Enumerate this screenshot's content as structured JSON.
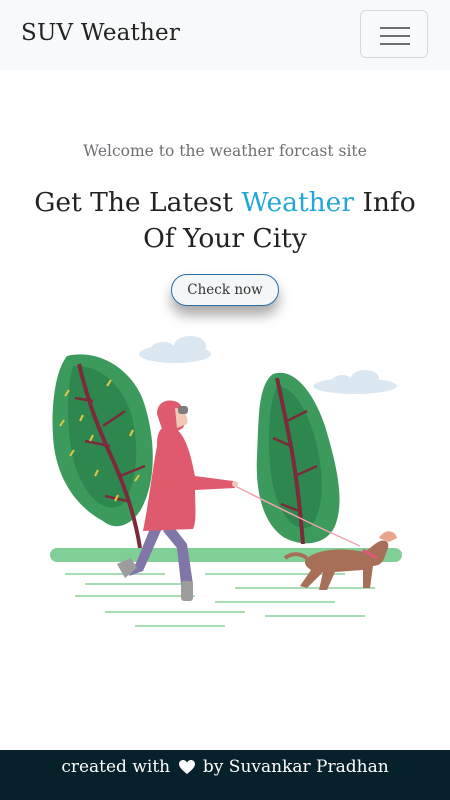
{
  "navbar": {
    "brand": "SUV Weather",
    "menu_icon": "hamburger-menu-icon"
  },
  "hero": {
    "welcome": "Welcome to the weather forcast site",
    "headline_prefix": "Get The Latest ",
    "headline_accent": "Weather",
    "headline_suffix": " Info Of Your City",
    "button_label": "Check now",
    "illustration": "woman-walking-dog-in-wind-illustration"
  },
  "footer": {
    "prefix": "created with",
    "heart_icon": "heart-icon",
    "suffix": "by Suvankar Pradhan"
  },
  "colors": {
    "accent": "#22a6d8",
    "footer_bg": "#06202c",
    "navbar_bg": "#f8f9fa"
  }
}
